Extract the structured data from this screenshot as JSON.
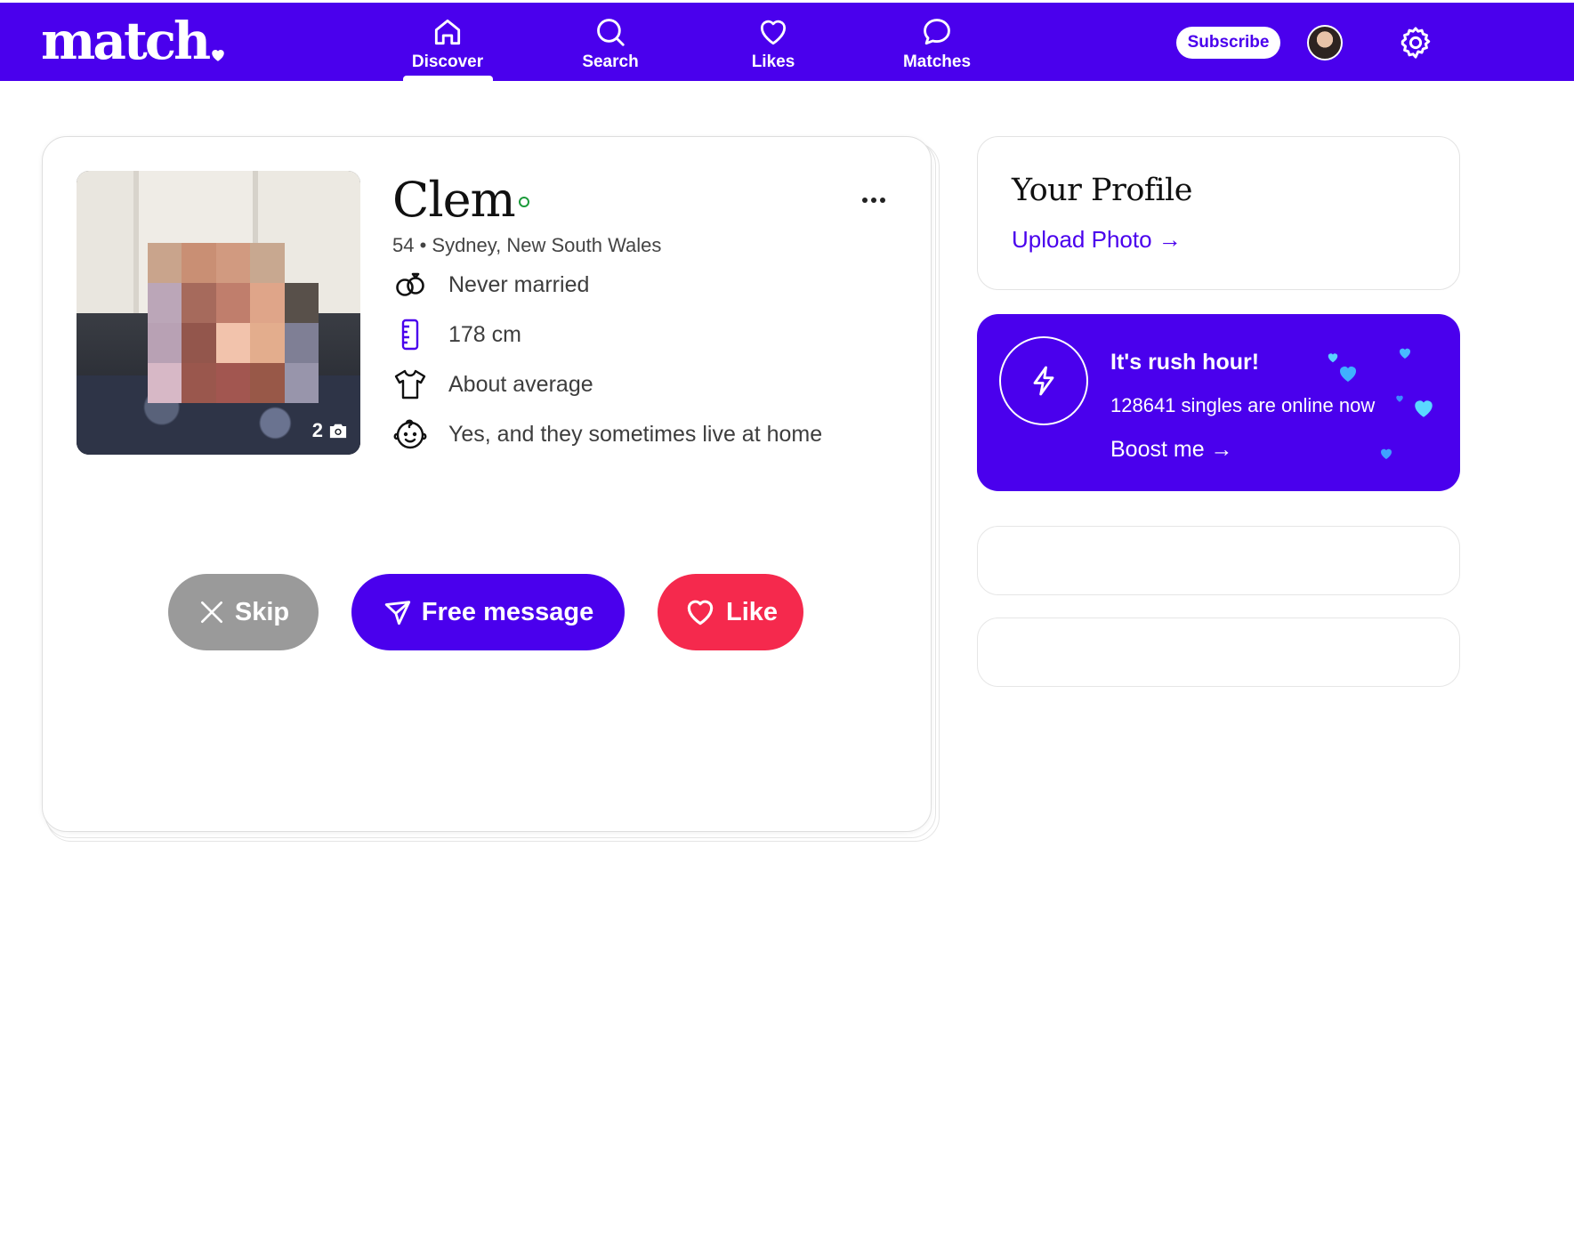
{
  "brand": {
    "logo_text": "match",
    "primary_color": "#4a00ed",
    "like_color": "#f5294d",
    "skip_color": "#9a9a9a"
  },
  "nav": {
    "items": [
      {
        "label": "Discover",
        "icon": "home-icon",
        "active": true
      },
      {
        "label": "Search",
        "icon": "search-icon",
        "active": false
      },
      {
        "label": "Likes",
        "icon": "heart-icon",
        "active": false
      },
      {
        "label": "Matches",
        "icon": "chat-bubble-icon",
        "active": false
      }
    ],
    "subscribe_label": "Subscribe",
    "settings_icon": "gear-icon"
  },
  "profile": {
    "name": "Clem",
    "online": true,
    "age_location": "54 • Sydney, New South Wales",
    "photo_count": "2",
    "attributes": [
      {
        "icon": "rings-icon",
        "text": "Never married"
      },
      {
        "icon": "ruler-icon",
        "text": "178 cm"
      },
      {
        "icon": "shirt-icon",
        "text": "About average"
      },
      {
        "icon": "child-face-icon",
        "text": "Yes, and they sometimes live at home"
      }
    ]
  },
  "actions": {
    "skip_label": "Skip",
    "message_label": "Free message",
    "like_label": "Like"
  },
  "your_profile": {
    "title": "Your Profile",
    "link_label": "Upload Photo →"
  },
  "rush_hour": {
    "title": "It's rush hour!",
    "subtitle": "128641 singles are online now",
    "boost_label": "Boost me →"
  }
}
